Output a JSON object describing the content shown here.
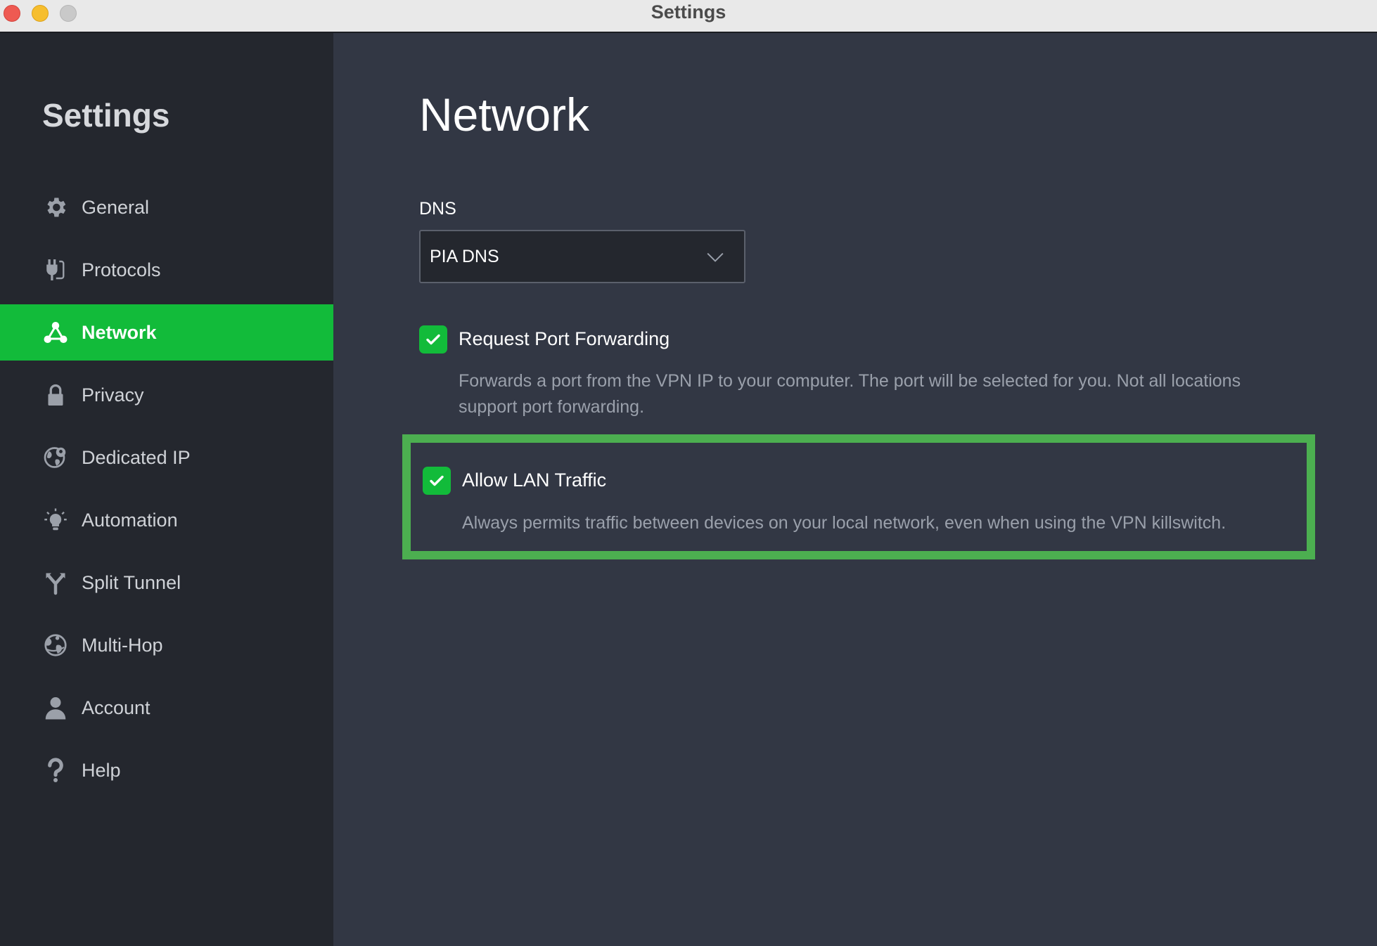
{
  "window": {
    "title": "Settings"
  },
  "sidebar": {
    "title": "Settings",
    "items": [
      {
        "label": "General",
        "icon": "gear-icon",
        "active": false
      },
      {
        "label": "Protocols",
        "icon": "plug-icon",
        "active": false
      },
      {
        "label": "Network",
        "icon": "network-icon",
        "active": true
      },
      {
        "label": "Privacy",
        "icon": "lock-icon",
        "active": false
      },
      {
        "label": "Dedicated IP",
        "icon": "dedicated-ip-icon",
        "active": false
      },
      {
        "label": "Automation",
        "icon": "lightbulb-icon",
        "active": false
      },
      {
        "label": "Split Tunnel",
        "icon": "split-tunnel-icon",
        "active": false
      },
      {
        "label": "Multi-Hop",
        "icon": "globe-icon",
        "active": false
      },
      {
        "label": "Account",
        "icon": "user-icon",
        "active": false
      },
      {
        "label": "Help",
        "icon": "question-icon",
        "active": false
      }
    ]
  },
  "main": {
    "title": "Network",
    "dns": {
      "label": "DNS",
      "selected": "PIA DNS"
    },
    "options": [
      {
        "label": "Request Port Forwarding",
        "checked": true,
        "description": "Forwards a port from the VPN IP to your computer. The port will be selected for you. Not all locations support port forwarding."
      },
      {
        "label": "Allow LAN Traffic",
        "checked": true,
        "description": "Always permits traffic between devices on your local network, even when using the VPN killswitch."
      }
    ]
  },
  "colors": {
    "accent": "#12bb3a",
    "highlight_border": "#4caf50",
    "sidebar_bg": "#24272e",
    "main_bg": "#323744"
  }
}
